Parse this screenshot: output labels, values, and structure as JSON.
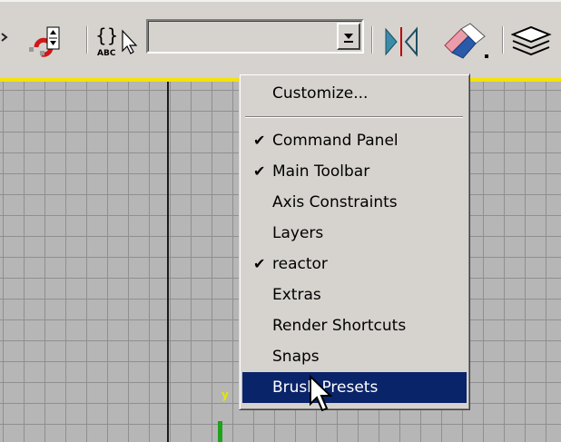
{
  "combo": {
    "value": ""
  },
  "menu": {
    "customize": "Customize...",
    "items": [
      {
        "label": "Command Panel",
        "checked": true
      },
      {
        "label": "Main Toolbar",
        "checked": true
      },
      {
        "label": "Axis Constraints",
        "checked": false
      },
      {
        "label": "Layers",
        "checked": false
      },
      {
        "label": "reactor",
        "checked": true
      },
      {
        "label": "Extras",
        "checked": false
      },
      {
        "label": "Render Shortcuts",
        "checked": false
      },
      {
        "label": "Snaps",
        "checked": false
      },
      {
        "label": "Brush Presets",
        "checked": false,
        "highlighted": true
      }
    ]
  },
  "viewport": {
    "axis_label": "y"
  },
  "colors": {
    "highlight": "#0a246a",
    "viewport_border": "#f4e20a",
    "y_axis": "#1fa01f"
  }
}
